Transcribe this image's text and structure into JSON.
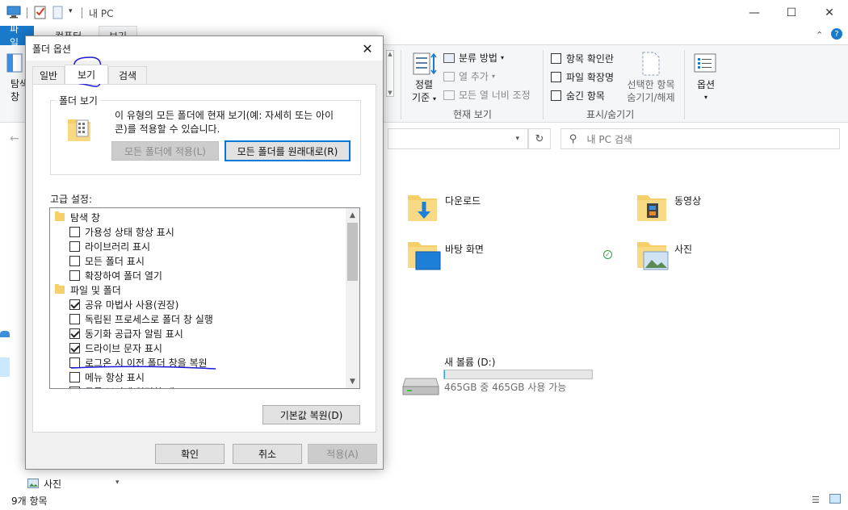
{
  "window": {
    "title": "내 PC"
  },
  "ribbon": {
    "tabs": [
      {
        "label": "파일"
      },
      {
        "label": "컴퓨터"
      },
      {
        "label": "보기"
      }
    ],
    "left_labels": {
      "line1": "탐색",
      "line2": "창"
    },
    "sort_btn": {
      "line1": "정렬",
      "line2": "기준"
    },
    "group_by": "분류 방법",
    "add_column": "열 추가",
    "fit_columns": "모든 열 너비 조정",
    "current_view_label": "현재 보기",
    "item_checkboxes": "항목 확인란",
    "file_extensions": "파일 확장명",
    "hidden_items": "숨긴 항목",
    "hide_selected": {
      "line1": "선택한 항목",
      "line2": "숨기기/해제"
    },
    "show_hide_label": "표시/숨기기",
    "options": "옵션"
  },
  "address": {
    "search_placeholder": "내 PC 검색"
  },
  "folders": [
    {
      "name": "다운로드"
    },
    {
      "name": "동영상"
    },
    {
      "name": "바탕 화면"
    },
    {
      "name": "사진"
    }
  ],
  "drive": {
    "name": "새 볼륨 (D:)",
    "free_text": "465GB 중 465GB 사용 가능",
    "used_fraction": 0.002
  },
  "nav": {
    "bottom_item": "사진"
  },
  "status": {
    "items": "9개 항목"
  },
  "dialog": {
    "title": "폴더 옵션",
    "tabs": [
      {
        "label": "일반"
      },
      {
        "label": "보기"
      },
      {
        "label": "검색"
      }
    ],
    "folder_view_legend": "폴더 보기",
    "folder_view_desc_line1": "이 유형의 모든 폴더에 현재 보기(예: 자세히 또는 아이",
    "folder_view_desc_line2": "콘)를 적용할 수 있습니다.",
    "apply_all": "모든 폴더에 적용(L)",
    "reset_all": "모든 폴더를 원래대로(R)",
    "advanced_label": "고급 설정:",
    "tree": [
      {
        "type": "folder",
        "label": "탐색 창",
        "indent": 0
      },
      {
        "type": "check",
        "label": "가용성 상태 항상 표시",
        "checked": false,
        "indent": 1
      },
      {
        "type": "check",
        "label": "라이브러리 표시",
        "checked": false,
        "indent": 1
      },
      {
        "type": "check",
        "label": "모든 폴더 표시",
        "checked": false,
        "indent": 1
      },
      {
        "type": "check",
        "label": "확장하여 폴더 열기",
        "checked": false,
        "indent": 1
      },
      {
        "type": "folder",
        "label": "파일 및 폴더",
        "indent": 0
      },
      {
        "type": "check",
        "label": "공유 마법사 사용(권장)",
        "checked": true,
        "indent": 1
      },
      {
        "type": "check",
        "label": "독립된 프로세스로 폴더 창 실행",
        "checked": false,
        "indent": 1
      },
      {
        "type": "check",
        "label": "동기화 공급자 알림 표시",
        "checked": true,
        "indent": 1
      },
      {
        "type": "check",
        "label": "드라이브 문자 표시",
        "checked": true,
        "indent": 1
      },
      {
        "type": "check",
        "label": "로그온 시 이전 폴더 창을 복원",
        "checked": false,
        "indent": 1
      },
      {
        "type": "check",
        "label": "메뉴 항상 표시",
        "checked": false,
        "indent": 1
      },
      {
        "type": "check",
        "label": "목록 보기에 입력할 때",
        "checked": false,
        "indent": 1
      }
    ],
    "restore_defaults": "기본값 복원(D)",
    "ok": "확인",
    "cancel": "취소",
    "apply": "적용(A)"
  }
}
